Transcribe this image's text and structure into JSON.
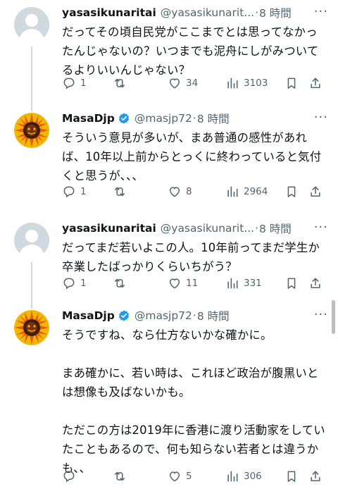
{
  "tweets": [
    {
      "name": "yasasikunaritai",
      "handle": "@yasasikunarit...",
      "sep": "·",
      "time": "8 時間",
      "text": "だってその頃自民党がここまでとは思ってなかったんじゃないの？いつまでも泥舟にしがみついてるよりいいんじゃない？",
      "replies": "1",
      "retweets": "",
      "likes": "34",
      "views": "3103"
    },
    {
      "name": "MasaDjp",
      "handle": "@masjp72",
      "sep": "·",
      "time": "8 時間",
      "text": "そういう意見が多いが、まあ普通の感性があれば、10年以上前からとっくに終わっていると気付くと思うが、、、",
      "replies": "1",
      "retweets": "",
      "likes": "8",
      "views": "2964"
    },
    {
      "name": "yasasikunaritai",
      "handle": "@yasasikunarit...",
      "sep": "·",
      "time": "8 時間",
      "text": "だってまだ若いよこの人。10年前ってまだ学生か卒業したばっかりくらいちがう？",
      "replies": "1",
      "retweets": "",
      "likes": "11",
      "views": "331"
    },
    {
      "name": "MasaDjp",
      "handle": "@masjp72",
      "sep": "·",
      "time": "8 時間",
      "text": "そうですね、なら仕方ないかな確かに。\n\nまあ確かに、若い時は、これほど政治が腹黒いとは想像も及ばないかも。\n\nただこの方は2019年に香港に渡り活動家をしていたこともあるので、何も知らない若者とは違うかも、、",
      "replies": "",
      "retweets": "",
      "likes": "5",
      "views": "306"
    }
  ],
  "more_label": "···",
  "colors": {
    "accent": "#1d9bf0",
    "muted": "#536471",
    "line": "#cfd9de"
  }
}
